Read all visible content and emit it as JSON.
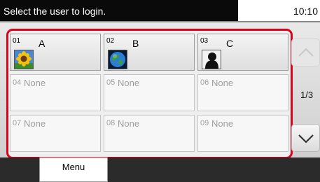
{
  "header": {
    "title": "Select the user to login.",
    "clock": "10:10"
  },
  "users": [
    {
      "number": "01",
      "name": "A",
      "icon": "sunflower-icon"
    },
    {
      "number": "02",
      "name": "B",
      "icon": "globe-icon"
    },
    {
      "number": "03",
      "name": "C",
      "icon": "silhouette-icon"
    },
    {
      "number": "04",
      "name": "None"
    },
    {
      "number": "05",
      "name": "None"
    },
    {
      "number": "06",
      "name": "None"
    },
    {
      "number": "07",
      "name": "None"
    },
    {
      "number": "08",
      "name": "None"
    },
    {
      "number": "09",
      "name": "None"
    }
  ],
  "pager": {
    "indicator": "1/3",
    "up_icon": "chevron-up-icon",
    "down_icon": "chevron-down-icon"
  },
  "bottom": {
    "menu_label": "Menu"
  },
  "colors": {
    "selection_frame": "#e0001a",
    "header_background": "#0a0a0a"
  }
}
